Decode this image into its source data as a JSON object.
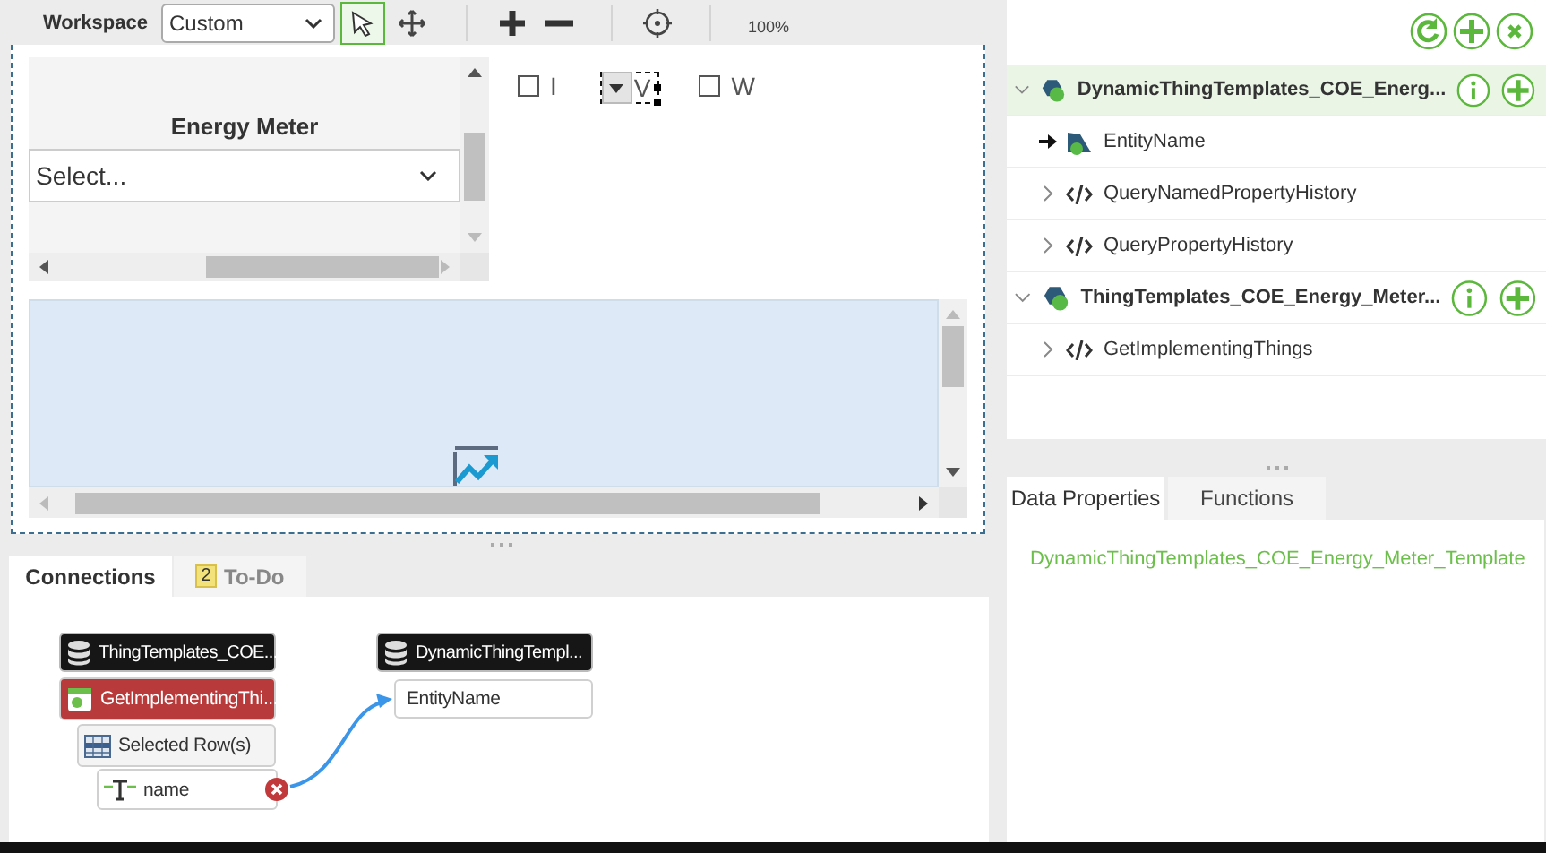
{
  "toolbar": {
    "workspace_label": "Workspace",
    "workspace_select": "Custom",
    "tools": [
      {
        "kind": "select",
        "selected": true
      },
      {
        "kind": "pan",
        "selected": false
      }
    ],
    "zoom": "100%"
  },
  "canvas": {
    "widget_title": "Energy Meter",
    "select_placeholder": "Select...",
    "controls": [
      {
        "kind": "checkbox",
        "label": "I",
        "checked": false
      },
      {
        "kind": "dropdown",
        "label": "V"
      },
      {
        "kind": "checkbox",
        "label": "W",
        "checked": false
      }
    ]
  },
  "bottom_tabs": [
    {
      "label": "Connections",
      "selected": true
    },
    {
      "label": "To-Do",
      "badge": "2",
      "selected": false
    }
  ],
  "connections": {
    "sources": [
      {
        "kind": "source",
        "text": "ThingTemplates_COE..."
      },
      {
        "kind": "service",
        "text": "GetImplementingThi..."
      },
      {
        "kind": "rows",
        "text": "Selected Row(s)"
      },
      {
        "kind": "field",
        "text": "name",
        "error": true
      }
    ],
    "targets": [
      {
        "kind": "source",
        "text": "DynamicThingTempl..."
      },
      {
        "kind": "param",
        "text": "EntityName"
      }
    ]
  },
  "tree": [
    {
      "label": "DynamicThingTemplates_COE_Energ...",
      "selected": true,
      "expanded": true,
      "children": [
        {
          "kind": "property",
          "label": "EntityName"
        },
        {
          "kind": "service",
          "label": "QueryNamedPropertyHistory",
          "expanded": false
        },
        {
          "kind": "service",
          "label": "QueryPropertyHistory",
          "expanded": false
        }
      ]
    },
    {
      "label": "ThingTemplates_COE_Energy_Meter...",
      "selected": false,
      "expanded": true,
      "children": [
        {
          "kind": "service",
          "label": "GetImplementingThings",
          "expanded": false
        }
      ]
    }
  ],
  "properties_tabs": [
    {
      "label": "Data Properties",
      "selected": true
    },
    {
      "label": "Functions",
      "selected": false
    }
  ],
  "properties_content": "DynamicThingTemplates_COE_Energy_Meter_Template"
}
